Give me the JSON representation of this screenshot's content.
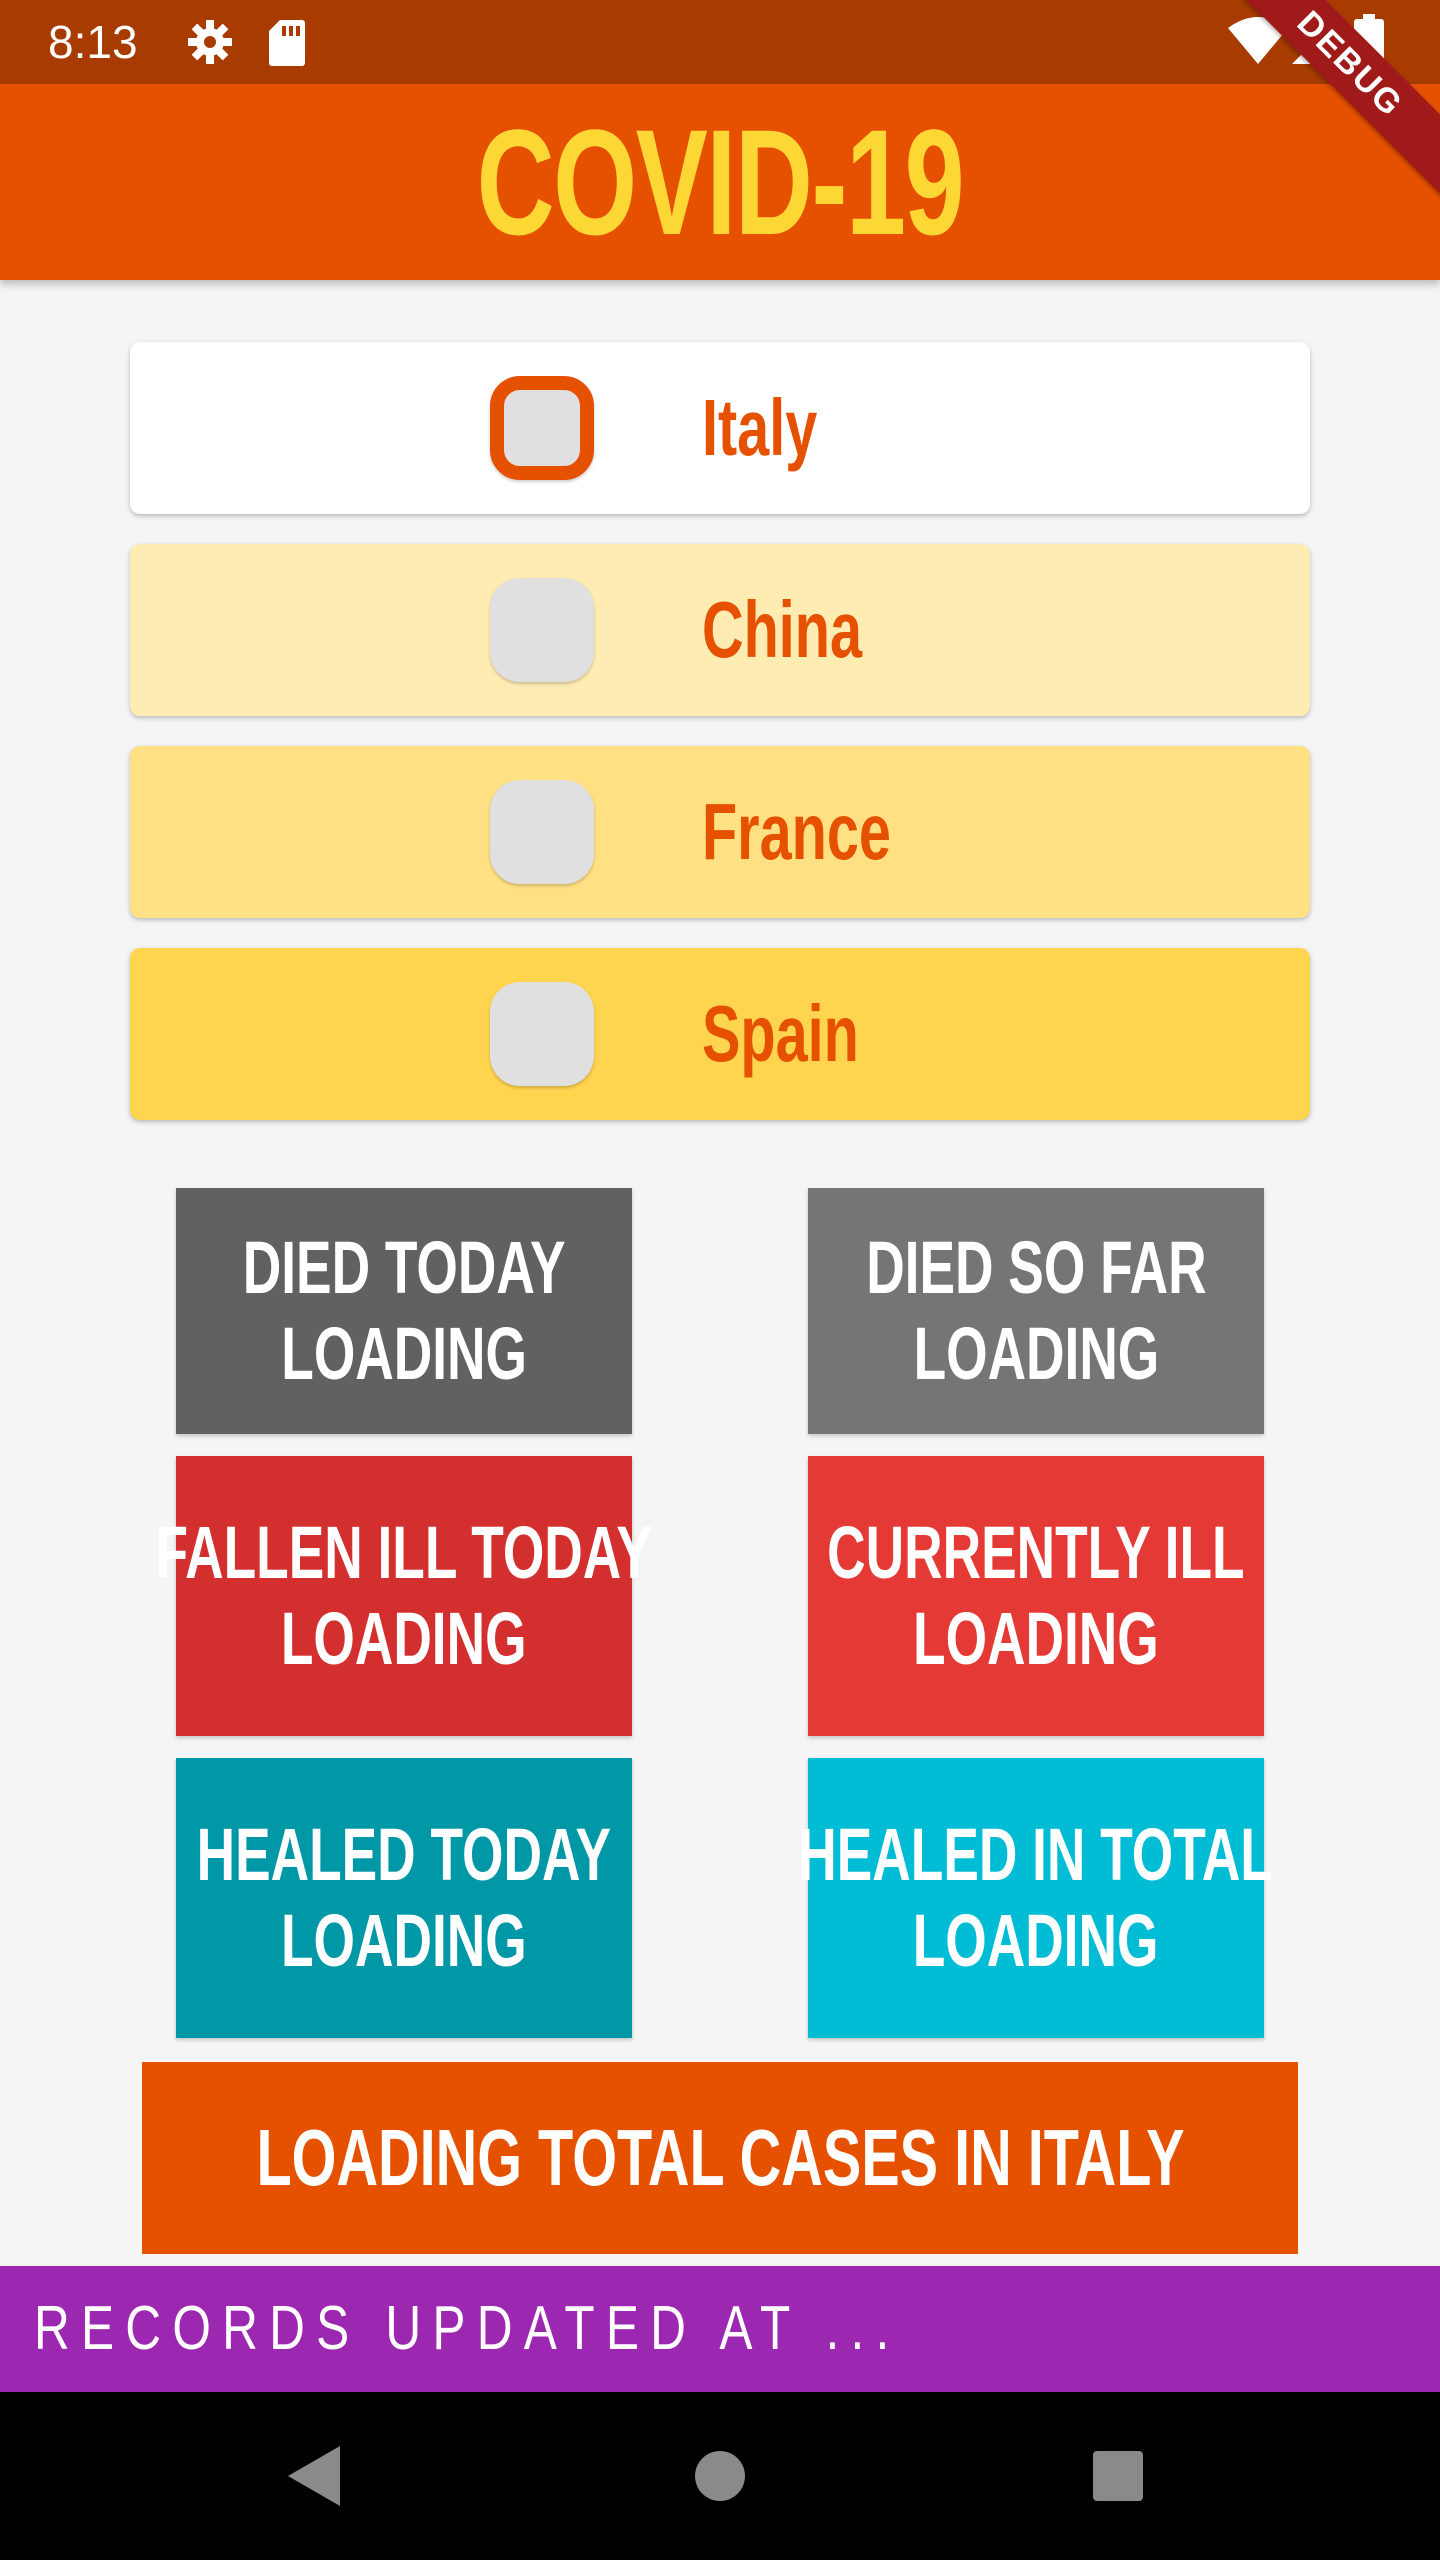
{
  "status_bar": {
    "time": "8:13",
    "icons": [
      "gear-icon",
      "sd-card-icon",
      "wifi-icon",
      "signal-icon",
      "battery-icon"
    ]
  },
  "app_bar": {
    "title": "COVID-19"
  },
  "debug_banner": {
    "label": "DEBUG"
  },
  "countries": [
    {
      "label": "Italy",
      "selected": true,
      "bg_color": "#ffffff"
    },
    {
      "label": "China",
      "selected": false,
      "bg_color": "#ffecb3"
    },
    {
      "label": "France",
      "selected": false,
      "bg_color": "#ffe082"
    },
    {
      "label": "Spain",
      "selected": false,
      "bg_color": "#ffd54f"
    }
  ],
  "stats": [
    {
      "title": "DIED TODAY",
      "value": "LOADING",
      "color": "#616161"
    },
    {
      "title": "DIED SO FAR",
      "value": "LOADING",
      "color": "#757575"
    },
    {
      "title": "FALLEN ILL TODAY",
      "value": "LOADING",
      "color": "#d32f2f"
    },
    {
      "title": "CURRENTLY ILL",
      "value": "LOADING",
      "color": "#e53935"
    },
    {
      "title": "HEALED TODAY",
      "value": "LOADING",
      "color": "#0097a7"
    },
    {
      "title": "HEALED IN TOTAL",
      "value": "LOADING",
      "color": "#00bcd4"
    }
  ],
  "total_banner": {
    "label": "LOADING TOTAL CASES IN ITALY"
  },
  "records_bar": {
    "label": "RECORDS UPDATED AT ..."
  },
  "colors": {
    "accent": "#e65100",
    "title": "#fdd835",
    "status_bar": "#a83c00",
    "records_bar": "#9c27b0"
  },
  "nav_bar": {
    "icons": [
      "back-icon",
      "home-icon",
      "recents-icon"
    ]
  }
}
